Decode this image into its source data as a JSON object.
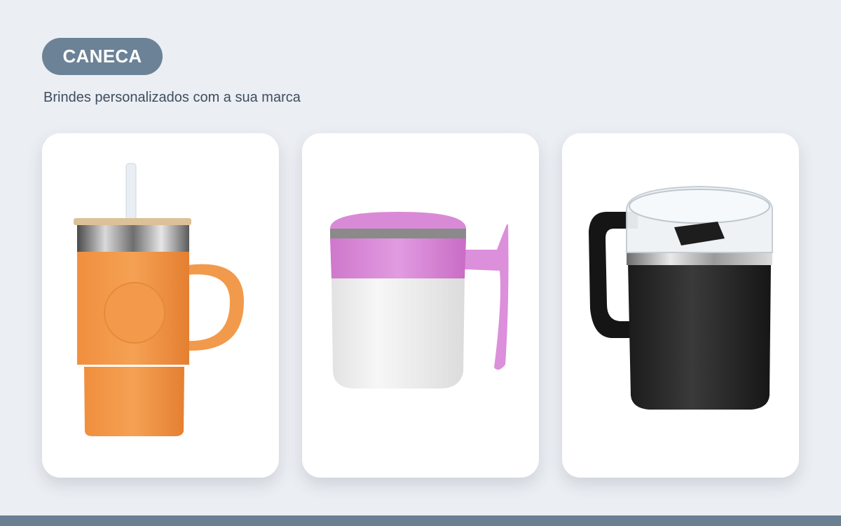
{
  "header": {
    "badge_label": "CANECA",
    "subtitle": "Brindes personalizados com a sua marca"
  },
  "products": [
    {
      "image": "orange-mug-with-bamboo-lid-and-straw"
    },
    {
      "image": "white-and-pink-mug-with-lid"
    },
    {
      "image": "black-steel-mug-with-clear-lid"
    }
  ],
  "colors": {
    "background": "#ebeef3",
    "badge": "#6c8296",
    "footer": "#6b7f92",
    "card": "#ffffff"
  }
}
